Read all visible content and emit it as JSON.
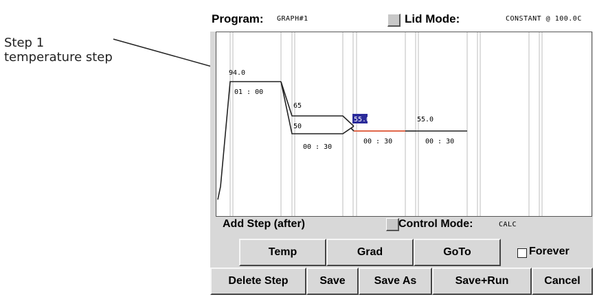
{
  "callout": {
    "line1": "Step 1",
    "line2": "temperature step"
  },
  "header": {
    "program_label": "Program:",
    "program_value": "GRAPH#1",
    "lid_label": "Lid Mode:",
    "lid_value": "CONSTANT @ 100.0C"
  },
  "graph": {
    "labels": {
      "t1": "94.0",
      "h1": "01 : 00",
      "t2a": "65",
      "t2b": "50",
      "h2": "00 : 30",
      "t3": "55.0",
      "h3": "00 : 30",
      "t4": "55.0",
      "h4": "00 : 30"
    },
    "selected_color": "#2b2b9a",
    "selected_step_line_color": "#e0674a"
  },
  "controls": {
    "add_step_label": "Add Step (after)",
    "control_mode_label": "Control Mode:",
    "control_mode_value": "CALC",
    "temp": "Temp",
    "grad": "Grad",
    "goto": "GoTo",
    "forever": "Forever"
  },
  "bottom": {
    "delete_step": "Delete Step",
    "save": "Save",
    "save_as": "Save As",
    "save_run": "Save+Run",
    "cancel": "Cancel"
  }
}
